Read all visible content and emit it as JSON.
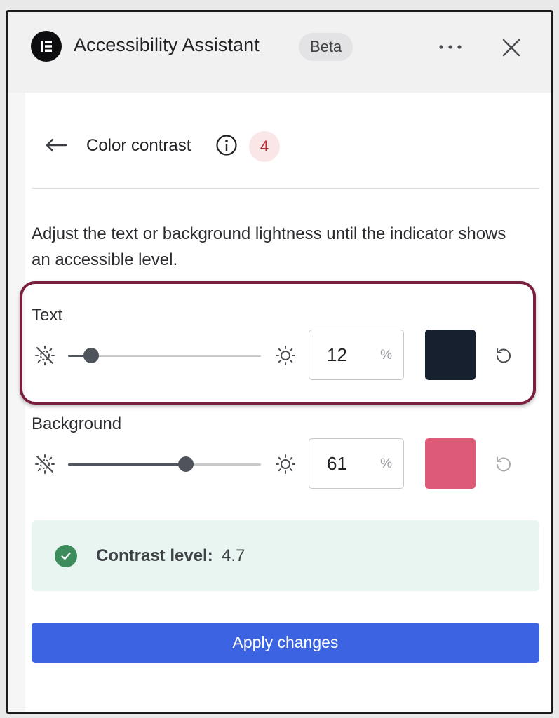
{
  "header": {
    "title": "Accessibility Assistant",
    "badge": "Beta",
    "logo_text": "IE"
  },
  "section": {
    "title": "Color contrast",
    "issue_count": "4"
  },
  "description": "Adjust the text or background lightness until the indicator shows an accessible level.",
  "text_row": {
    "label": "Text",
    "lightness": "12",
    "lightness_value": 12,
    "unit": "%",
    "swatch_color": "#17202e"
  },
  "background_row": {
    "label": "Background",
    "lightness": "61",
    "lightness_value": 61,
    "unit": "%",
    "swatch_color": "#dc5c78"
  },
  "contrast": {
    "label": "Contrast level:",
    "value": "4.7"
  },
  "apply_label": "Apply changes",
  "colors": {
    "accent": "#3b63e2",
    "highlight_border": "#7a1f3e",
    "success": "#3c8c5c",
    "badge_bg": "#fbe6e7",
    "badge_text": "#b12a30"
  }
}
